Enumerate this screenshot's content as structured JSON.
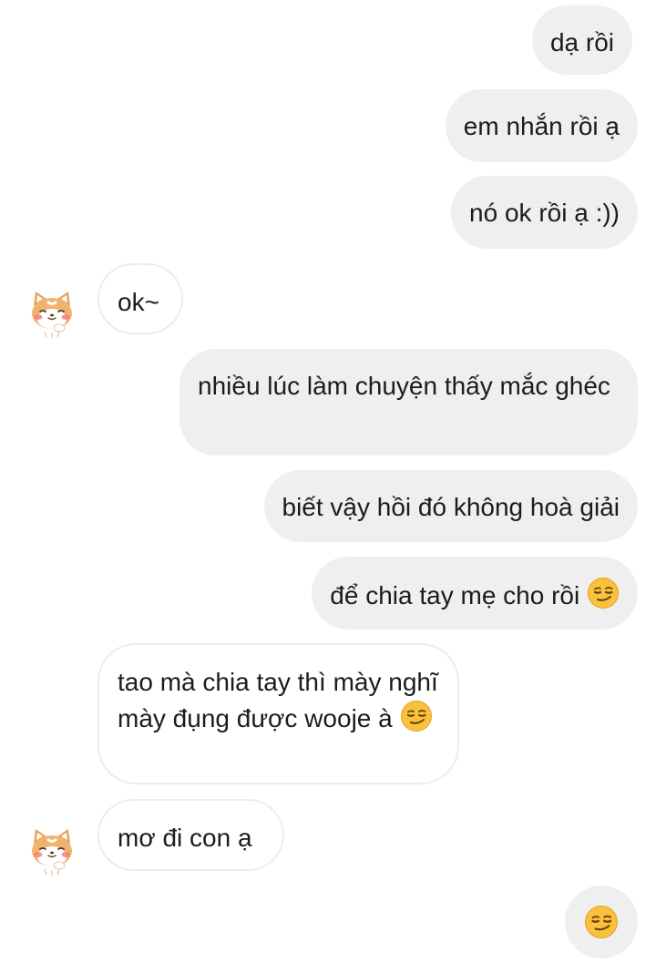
{
  "conversation": {
    "messages": [
      {
        "from": "me",
        "text": "dạ rồi"
      },
      {
        "from": "me",
        "text": "em nhắn rồi ạ"
      },
      {
        "from": "me",
        "text": "nó ok rồi ạ :))"
      },
      {
        "from": "them",
        "text": "ok~",
        "avatar": "shiba-avatar-icon"
      },
      {
        "from": "me",
        "text": "nhiều lúc làm chuyện thấy mắc ghéc"
      },
      {
        "from": "me",
        "text": "biết vậy hồi đó không hoà giải"
      },
      {
        "from": "me",
        "text": "để chia tay mẹ cho rồi",
        "emoji": "smirk-emoji-icon"
      },
      {
        "from": "them",
        "text": "tao mà chia tay thì mày nghĩ mày đụng được wooje à",
        "emoji": "smirk-emoji-icon"
      },
      {
        "from": "them",
        "text": "mơ đi con ạ",
        "avatar": "shiba-avatar-icon"
      },
      {
        "from": "me",
        "text": "",
        "emoji": "smirk-emoji-icon"
      }
    ]
  },
  "colors": {
    "sent_bubble": "#efefef",
    "received_bubble": "#ffffff",
    "received_border": "#ececec",
    "text": "#1c1c1c",
    "emoji_face": "#f9c23c"
  }
}
